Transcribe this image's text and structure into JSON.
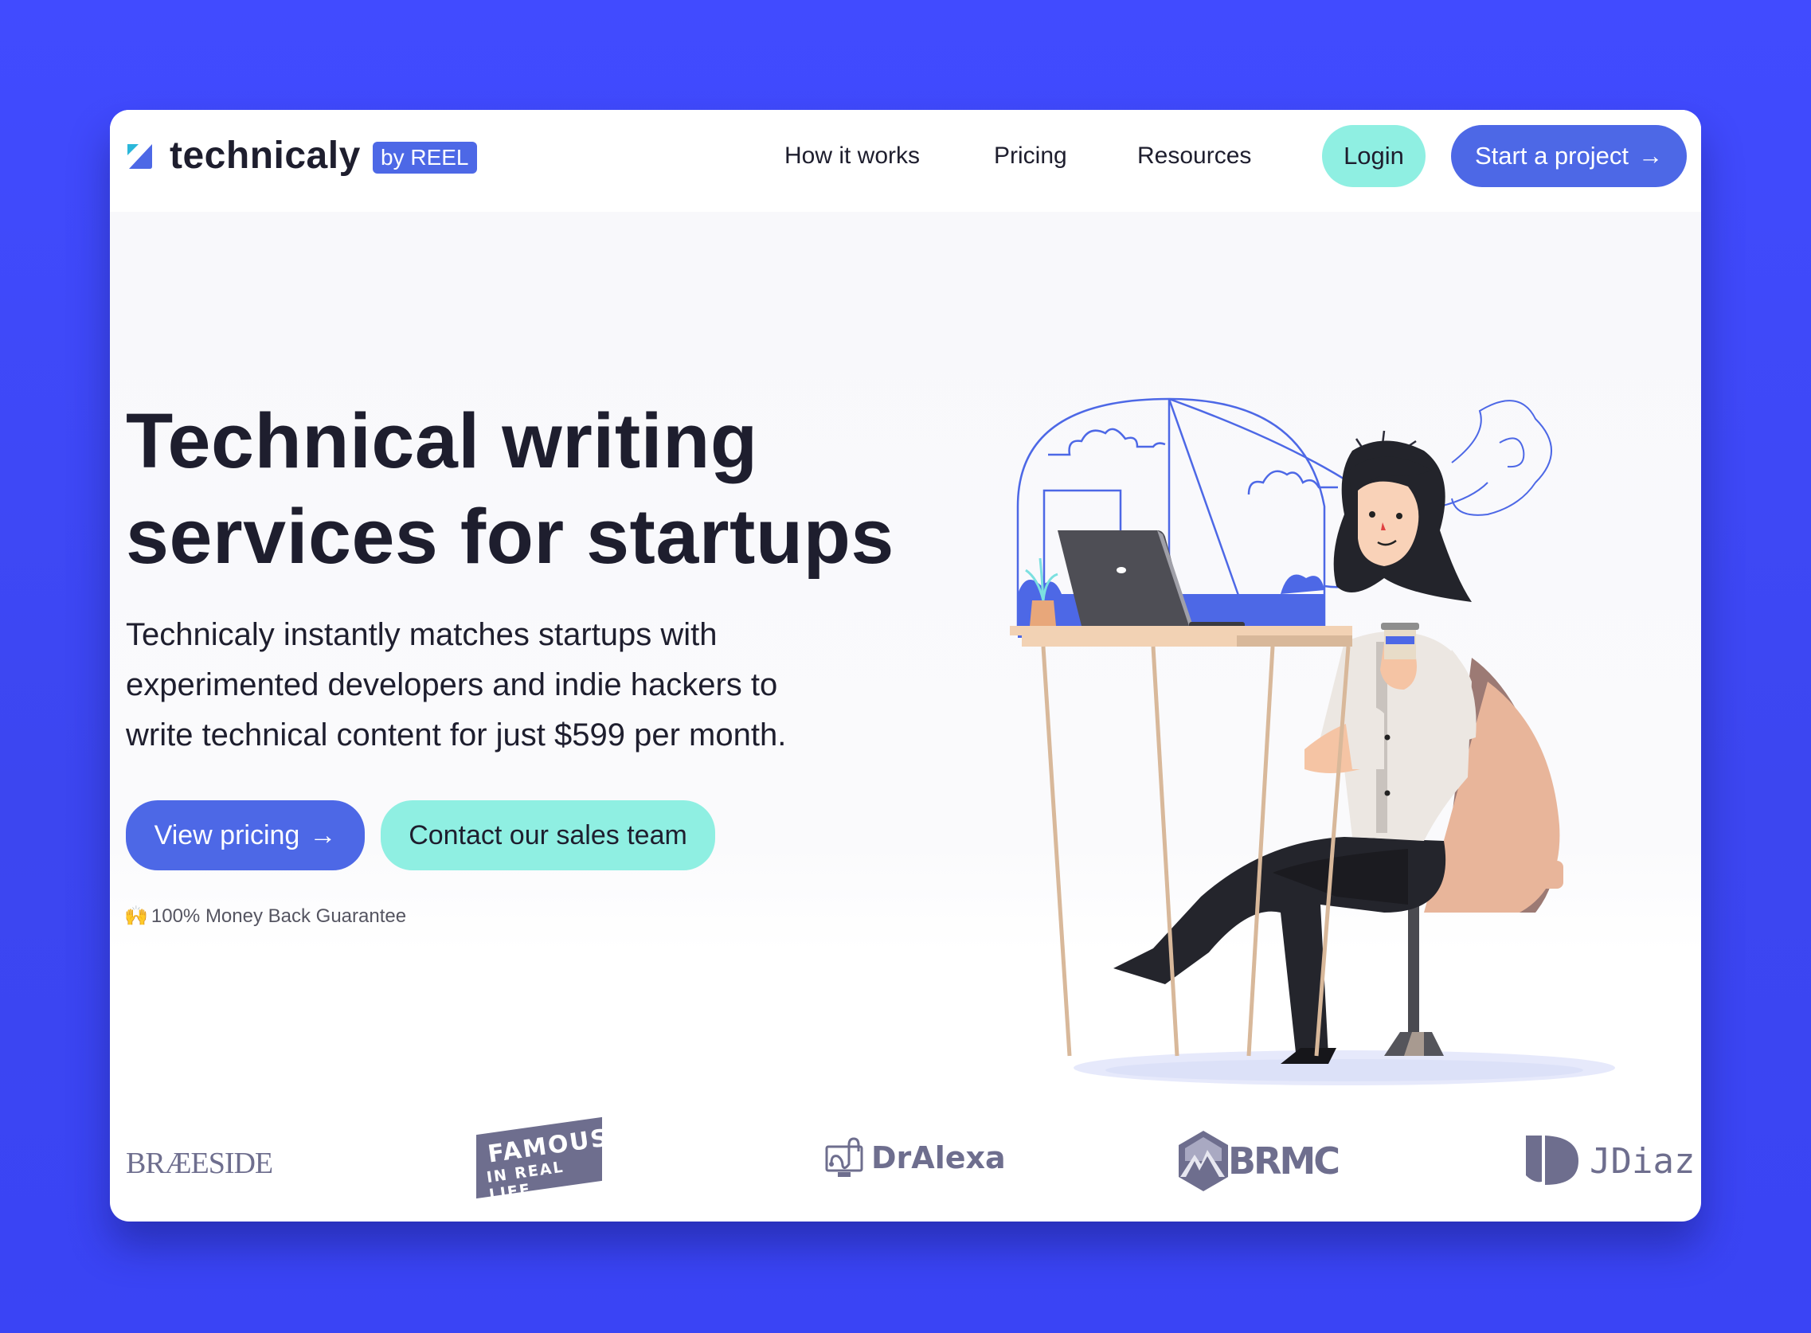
{
  "colors": {
    "background": "#414BFF",
    "primary": "#4D68E6",
    "accent": "#8FEFE2",
    "text": "#1E1E2E",
    "logo_gray": "#6E6E8E"
  },
  "nav": {
    "brand": "technicaly",
    "badge": "by REEL",
    "links": [
      {
        "label": "How it works"
      },
      {
        "label": "Pricing"
      },
      {
        "label": "Resources"
      }
    ],
    "login_label": "Login",
    "start_label": "Start a project",
    "arrow": "→"
  },
  "hero": {
    "headline_line1": "Technical writing",
    "headline_line2": "services for startups",
    "sub_line1": "Technicaly instantly matches startups with",
    "sub_line2": "experimented developers and indie hackers to",
    "sub_line3": "write technical content for just $599 per month.",
    "view_pricing_label": "View pricing",
    "contact_label": "Contact our sales team",
    "arrow": "→",
    "guarantee_emoji": "🙌",
    "guarantee_text": "100% Money Back Guarantee"
  },
  "logos": {
    "braeside": "BRÆESIDE",
    "famous_line1": "FAMOUS",
    "famous_line2": "IN REAL LIFE",
    "dralexa": "DrAlexa",
    "brmc": "BRMC",
    "jdiaz": "JDiaz"
  }
}
